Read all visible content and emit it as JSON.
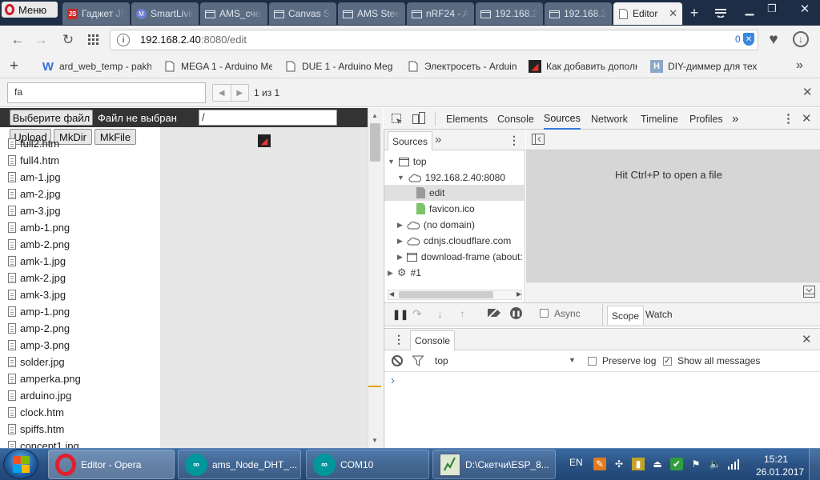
{
  "browser": {
    "menu_label": "Меню",
    "tabs": [
      {
        "label": "Гаджет JS",
        "icon": "jsg-icon"
      },
      {
        "label": "SmartLivin",
        "icon": "m-icon"
      },
      {
        "label": "AMS_счет",
        "icon": "folder-icon"
      },
      {
        "label": "Canvas St",
        "icon": "folder-icon"
      },
      {
        "label": "AMS Steel",
        "icon": "folder-icon"
      },
      {
        "label": "nRF24 - A",
        "icon": "folder-icon"
      },
      {
        "label": "192.168.2.",
        "icon": "folder-icon"
      },
      {
        "label": "192.168.2.",
        "icon": "folder-icon"
      },
      {
        "label": "Editor",
        "icon": "page-icon",
        "active": true
      }
    ],
    "address": {
      "host": "192.168.2.40",
      "rest": ":8080/edit",
      "badge": "0"
    },
    "bookmarks": [
      {
        "label": "ard_web_temp - pakh",
        "icon": "W"
      },
      {
        "label": "MEGA 1 - Arduino Me",
        "icon": "arduino"
      },
      {
        "label": "DUE 1 - Arduino Meg",
        "icon": "arduino"
      },
      {
        "label": "Электросеть - Arduin",
        "icon": "arduino"
      },
      {
        "label": "Как добавить дополн",
        "icon": "flame"
      },
      {
        "label": "DIY-диммер для тех.",
        "icon": "H"
      }
    ],
    "find": {
      "query": "fa",
      "count": "1 из 1"
    }
  },
  "page": {
    "choose_file": "Выберите файл",
    "no_file": "Файл не выбран",
    "path": "/",
    "upload": "Upload",
    "mkdir": "MkDir",
    "mkfile": "MkFile",
    "files": [
      "full2.htm",
      "full4.htm",
      "am-1.jpg",
      "am-2.jpg",
      "am-3.jpg",
      "amb-1.png",
      "amb-2.png",
      "amk-1.jpg",
      "amk-2.jpg",
      "amk-3.jpg",
      "amp-1.png",
      "amp-2.png",
      "amp-3.png",
      "solder.jpg",
      "amperka.png",
      "arduino.jpg",
      "clock.htm",
      "spiffs.htm",
      "concept1.jpg"
    ]
  },
  "devtools": {
    "tabs": [
      "Elements",
      "Console",
      "Sources",
      "Network",
      "Timeline",
      "Profiles"
    ],
    "active_tab": "Sources",
    "navigator_tab": "Sources",
    "tree": {
      "top": "top",
      "host": "192.168.2.40:8080",
      "edit": "edit",
      "favicon": "favicon.ico",
      "no_domain": "(no domain)",
      "cdn": "cdnjs.cloudflare.com",
      "download_frame": "download-frame (about:",
      "worker": "#1"
    },
    "editor_hint": "Hit Ctrl+P to open a file",
    "async_label": "Async",
    "scope_tab": "Scope",
    "watch_tab": "Watch",
    "console": {
      "title": "Console",
      "context": "top",
      "preserve_log": "Preserve log",
      "show_all": "Show all messages",
      "prompt": "›"
    }
  },
  "taskbar": {
    "items": [
      {
        "label": "Editor - Opera"
      },
      {
        "label": "ams_Node_DHT_..."
      },
      {
        "label": "COM10"
      },
      {
        "label": "D:\\Скетчи\\ESP_8..."
      }
    ],
    "lang": "EN",
    "time": "15:21",
    "date": "26.01.2017"
  }
}
